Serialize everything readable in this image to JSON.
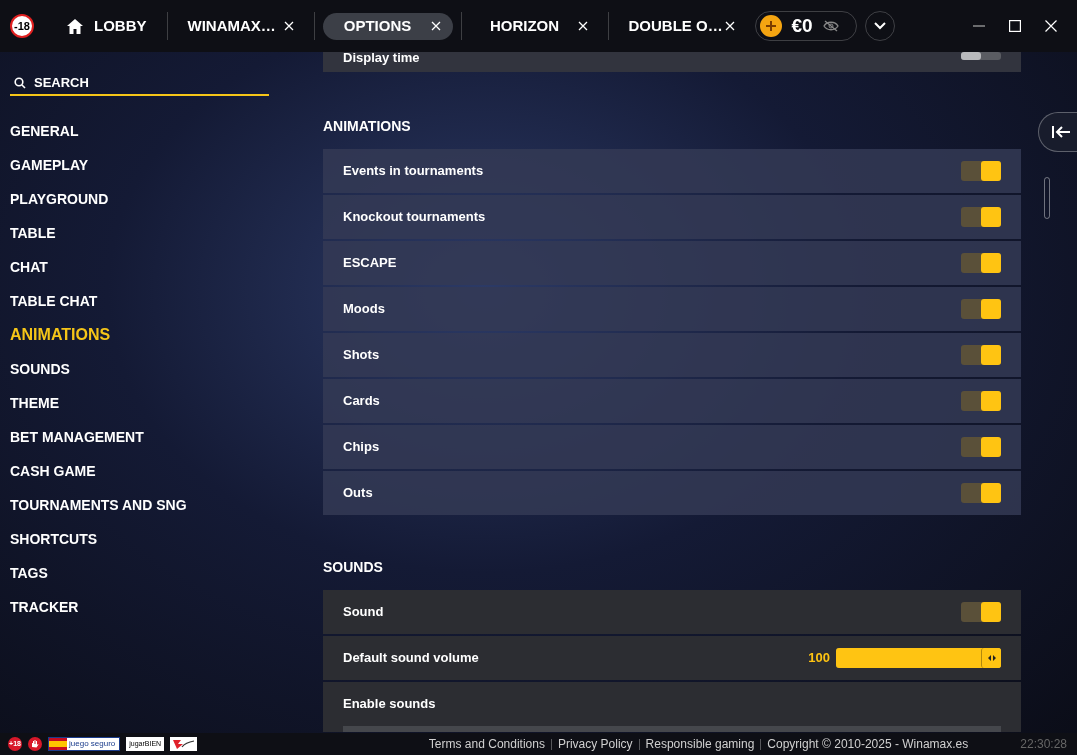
{
  "age_badge": "-18",
  "tabs": [
    {
      "label": "LOBBY",
      "kind": "home",
      "selected": false,
      "closable": false
    },
    {
      "label": "WINAMAX…",
      "kind": "plain",
      "selected": false,
      "closable": true
    },
    {
      "label": "OPTIONS",
      "kind": "plain",
      "selected": true,
      "closable": true
    },
    {
      "label": "HORIZON",
      "kind": "plain",
      "selected": false,
      "closable": true
    },
    {
      "label": "DOUBLE O…",
      "kind": "plain",
      "selected": false,
      "closable": true
    }
  ],
  "balance": {
    "amount": "€0"
  },
  "search": {
    "placeholder": "SEARCH"
  },
  "sidebar": {
    "items": [
      {
        "label": "GENERAL",
        "selected": false
      },
      {
        "label": "GAMEPLAY",
        "selected": false
      },
      {
        "label": "PLAYGROUND",
        "selected": false
      },
      {
        "label": "TABLE",
        "selected": false
      },
      {
        "label": "CHAT",
        "selected": false
      },
      {
        "label": "TABLE CHAT",
        "selected": false
      },
      {
        "label": "ANIMATIONS",
        "selected": true
      },
      {
        "label": "SOUNDS",
        "selected": false
      },
      {
        "label": "THEME",
        "selected": false
      },
      {
        "label": "BET MANAGEMENT",
        "selected": false
      },
      {
        "label": "CASH GAME",
        "selected": false
      },
      {
        "label": "TOURNAMENTS AND SNG",
        "selected": false
      },
      {
        "label": "SHORTCUTS",
        "selected": false
      },
      {
        "label": "TAGS",
        "selected": false
      },
      {
        "label": "TRACKER",
        "selected": false
      }
    ]
  },
  "top_row": {
    "label": "Display time",
    "kind": "toggle",
    "on": false
  },
  "sections": [
    {
      "title": "ANIMATIONS",
      "rows": [
        {
          "label": "Events in tournaments",
          "kind": "toggle",
          "on": true
        },
        {
          "label": "Knockout tournaments",
          "kind": "toggle",
          "on": true
        },
        {
          "label": "ESCAPE",
          "kind": "toggle",
          "on": true
        },
        {
          "label": "Moods",
          "kind": "toggle",
          "on": true
        },
        {
          "label": "Shots",
          "kind": "toggle",
          "on": true
        },
        {
          "label": "Cards",
          "kind": "toggle",
          "on": true
        },
        {
          "label": "Chips",
          "kind": "toggle",
          "on": true
        },
        {
          "label": "Outs",
          "kind": "toggle",
          "on": true
        }
      ]
    },
    {
      "title": "SOUNDS",
      "rows": [
        {
          "label": "Sound",
          "kind": "toggle",
          "on": true
        },
        {
          "label": "Default sound volume",
          "kind": "slider",
          "reading": "100",
          "level": 1
        },
        {
          "label": "Enable sounds",
          "kind": "group"
        }
      ]
    }
  ],
  "footer": {
    "badges": [
      {
        "kind": "age",
        "text": "+18"
      },
      {
        "kind": "hand"
      },
      {
        "kind": "juego",
        "text": "juego seguro"
      },
      {
        "kind": "jugar",
        "text": "jugarBIEN"
      },
      {
        "kind": "fejar"
      }
    ],
    "links": [
      "Terms and Conditions",
      "Privacy Policy",
      "Responsible gaming",
      "Copyright © 2010-2025 - Winamax.es"
    ],
    "time": "22:30:28"
  }
}
